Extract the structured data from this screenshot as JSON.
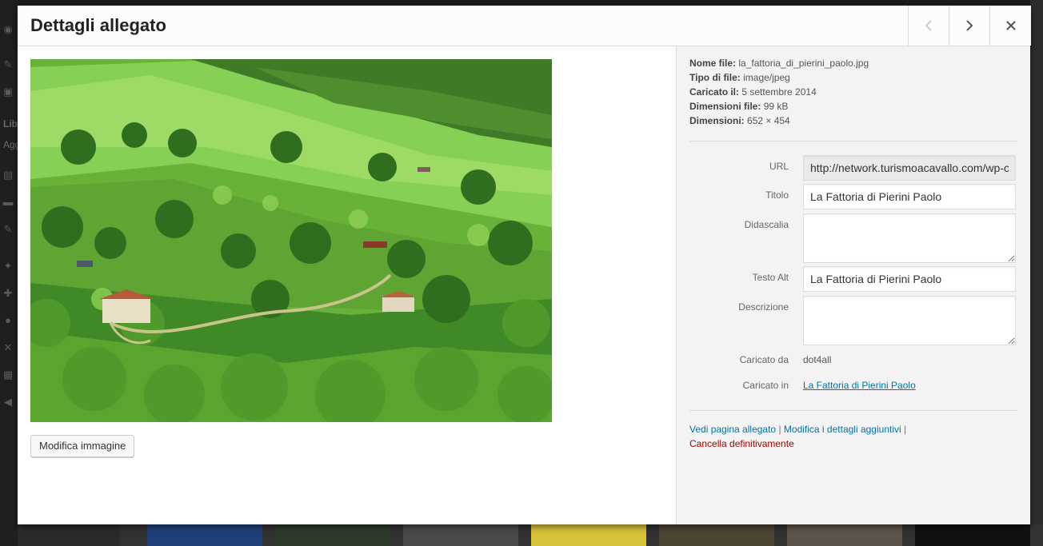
{
  "modal": {
    "title": "Dettagli allegato",
    "prev_label": "Allegato precedente",
    "next_label": "Allegato successivo",
    "close_label": "Chiudi"
  },
  "media": {
    "edit_button": "Modifica immagine"
  },
  "file_info": {
    "filename_label": "Nome file:",
    "filename": "la_fattoria_di_pierini_paolo.jpg",
    "filetype_label": "Tipo di file:",
    "filetype": "image/jpeg",
    "uploaded_label": "Caricato il:",
    "uploaded": "5 settembre 2014",
    "filesize_label": "Dimensioni file:",
    "filesize": "99 kB",
    "dimensions_label": "Dimensioni:",
    "dimensions": "652 × 454"
  },
  "fields": {
    "url_label": "URL",
    "url_value": "http://network.turismoacavallo.com/wp-content/uploads/la_fattoria_di_pierini_paolo.jpg",
    "title_label": "Titolo",
    "title_value": "La Fattoria di Pierini Paolo",
    "caption_label": "Didascalia",
    "caption_value": "",
    "alt_label": "Testo Alt",
    "alt_value": "La Fattoria di Pierini Paolo",
    "description_label": "Descrizione",
    "description_value": "",
    "uploaded_by_label": "Caricato da",
    "uploaded_by": "dot4all",
    "uploaded_to_label": "Caricato in",
    "uploaded_to": "La Fattoria di Pierini Paolo"
  },
  "actions": {
    "view_page": "Vedi pagina allegato",
    "edit_more": "Modifica i dettagli aggiuntivi",
    "delete": "Cancella definitivamente",
    "separator": "|"
  },
  "background": {
    "sidebar_text_1": "Lib",
    "sidebar_text_2": "Agg"
  },
  "colors": {
    "link": "#0073aa",
    "delete": "#aa0000",
    "panel_bg": "#f3f3f3"
  }
}
